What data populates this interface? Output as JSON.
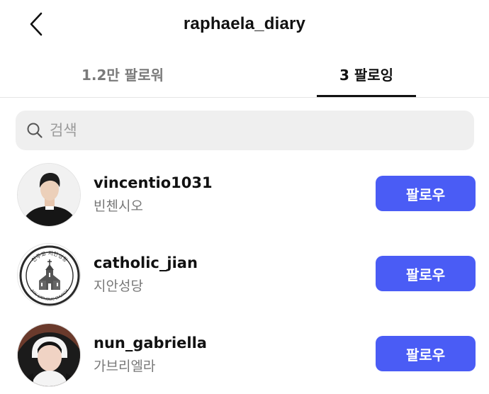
{
  "header": {
    "title": "raphaela_diary"
  },
  "tabs": [
    {
      "label": "1.2만 팔로워",
      "active": false
    },
    {
      "label": "3 팔로잉",
      "active": true
    }
  ],
  "search": {
    "placeholder": "검색"
  },
  "following": [
    {
      "username": "vincentio1031",
      "name": "빈첸시오",
      "button": "팔로우"
    },
    {
      "username": "catholic_jian",
      "name": "지안성당",
      "button": "팔로우",
      "avatar_logo": {
        "top_text": "천주교 지안성당",
        "bottom_text": "JIAN CATHOLIC CHURCH"
      }
    },
    {
      "username": "nun_gabriella",
      "name": "가브리엘라",
      "button": "팔로우"
    }
  ],
  "colors": {
    "accent": "#4a5cf5",
    "secondary_text": "#777777",
    "search_bg": "#efefef"
  }
}
